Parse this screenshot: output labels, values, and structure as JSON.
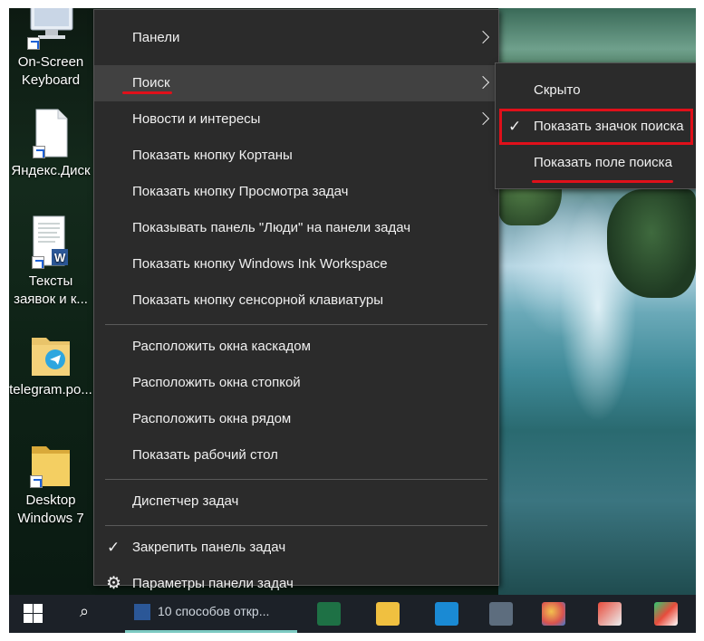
{
  "desktop": {
    "icons": [
      {
        "label_lines": [
          "On-Screen",
          "Keyboard"
        ],
        "icon": "keyboard-icon"
      },
      {
        "label_lines": [
          "Яндекс.Диск"
        ],
        "icon": "document-icon"
      },
      {
        "label_lines": [
          "Тексты",
          "заявок и к..."
        ],
        "icon": "word-document-icon"
      },
      {
        "label_lines": [
          "telegram.po..."
        ],
        "icon": "telegram-folder-icon"
      },
      {
        "label_lines": [
          "Desktop",
          "Windows 7"
        ],
        "icon": "folder-icon"
      }
    ]
  },
  "context_menu": {
    "items": [
      {
        "label": "Панели",
        "submenu": true
      },
      {
        "label": "Поиск",
        "submenu": true
      },
      {
        "label": "Новости и интересы",
        "submenu": true
      },
      {
        "label": "Показать кнопку Кортаны"
      },
      {
        "label": "Показать кнопку Просмотра задач"
      },
      {
        "label": "Показывать панель \"Люди\" на панели задач"
      },
      {
        "label": "Показать кнопку Windows Ink Workspace"
      },
      {
        "label": "Показать кнопку сенсорной клавиатуры"
      },
      {
        "label": "Расположить окна каскадом"
      },
      {
        "label": "Расположить окна стопкой"
      },
      {
        "label": "Расположить окна рядом"
      },
      {
        "label": "Показать рабочий стол"
      },
      {
        "label": "Диспетчер задач"
      },
      {
        "label": "Закрепить панель задач",
        "checked": true
      },
      {
        "label": "Параметры панели задач",
        "icon": "gear-icon"
      }
    ]
  },
  "submenu_search": {
    "items": [
      {
        "label": "Скрыто"
      },
      {
        "label": "Показать значок поиска",
        "checked": true
      },
      {
        "label": "Показать поле поиска"
      }
    ]
  },
  "taskbar": {
    "active_window_label": "10 способов откр..."
  },
  "glyphs": {
    "check": "✓",
    "gear": "⚙",
    "search": "⌕"
  },
  "colors": {
    "menu_bg": "#2b2b2b",
    "menu_hover": "#414141",
    "annotation_red": "#e0101a",
    "taskbar_bg": "#1c2128"
  }
}
